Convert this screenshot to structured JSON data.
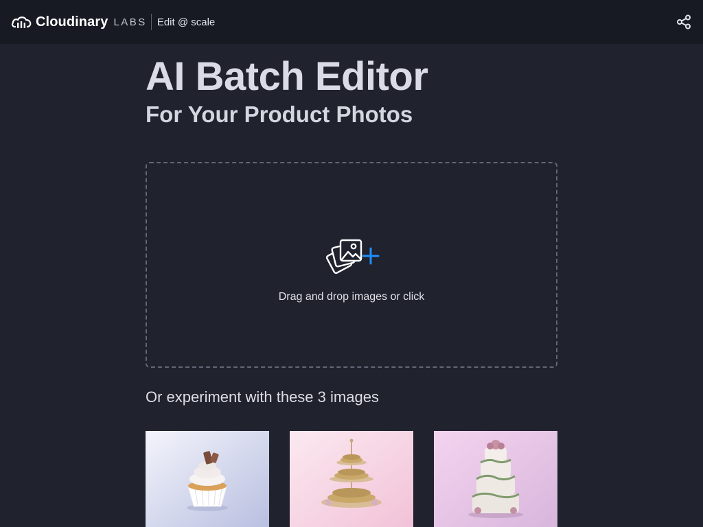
{
  "header": {
    "brand_name": "Cloudinary",
    "brand_suffix": "LABS",
    "product": "Edit @ scale",
    "share_icon": "share-icon"
  },
  "hero": {
    "title": "AI Batch Editor",
    "subtitle": "For Your Product Photos"
  },
  "dropzone": {
    "icon": "add-images-icon",
    "text": "Drag and drop images or click",
    "accent_color": "#1e90ff"
  },
  "samples": {
    "heading": "Or experiment with these 3 images",
    "images": [
      {
        "name": "cupcake-image"
      },
      {
        "name": "macaron-stand-image"
      },
      {
        "name": "wedding-cake-image"
      }
    ]
  },
  "colors": {
    "background": "#20222d",
    "topbar": "#171a23"
  }
}
